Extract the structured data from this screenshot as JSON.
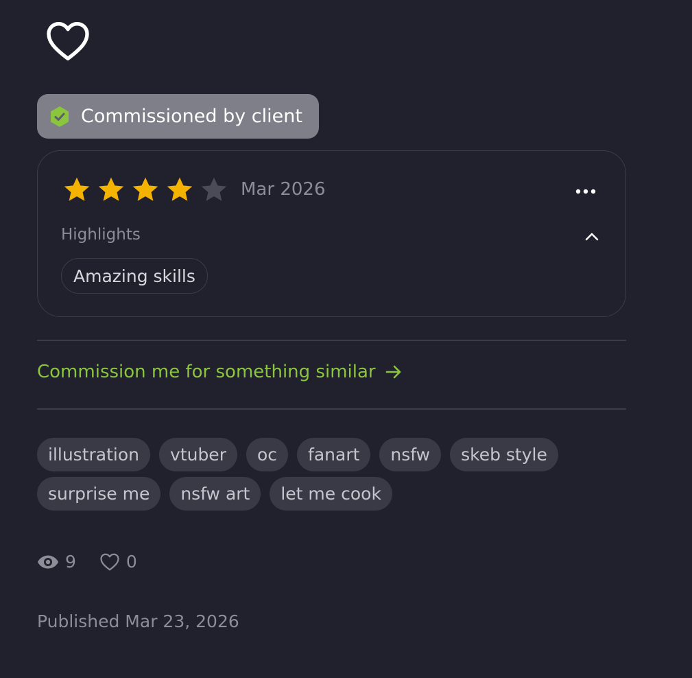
{
  "colors": {
    "background": "#21212d",
    "badge_bg": "#7e7f88",
    "verified_green": "#8bc53f",
    "star_filled": "#f5b301",
    "star_empty": "#4a4b57",
    "link_green": "#8bc53f",
    "muted_text": "#8c8d97",
    "tag_bg": "#393a46"
  },
  "favorite_button": {
    "icon": "heart-outline-icon"
  },
  "badge": {
    "icon": "verified-hexagon-icon",
    "label": "Commissioned by client"
  },
  "review": {
    "rating": 4,
    "max_rating": 5,
    "date": "Mar 2026",
    "more_icon": "more-horizontal-icon",
    "highlights_label": "Highlights",
    "collapse_icon": "chevron-up-icon",
    "highlights": [
      "Amazing skills"
    ]
  },
  "commission_link": {
    "label": "Commission me for something similar",
    "icon": "arrow-right-icon"
  },
  "tags": {
    "row1": [
      "illustration",
      "vtuber",
      "oc",
      "fanart",
      "nsfw",
      "skeb style"
    ],
    "row2": [
      "surprise me",
      "nsfw art",
      "let me cook"
    ]
  },
  "stats": {
    "views": {
      "icon": "eye-icon",
      "count": "9"
    },
    "likes": {
      "icon": "heart-outline-icon",
      "count": "0"
    }
  },
  "published": "Published Mar 23, 2026"
}
